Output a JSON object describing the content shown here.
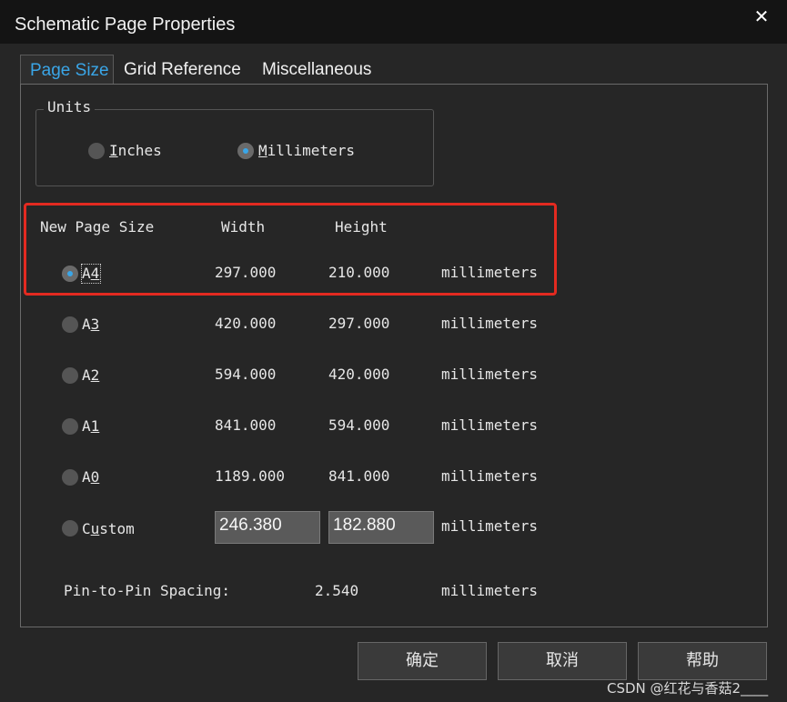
{
  "window": {
    "title": "Schematic Page Properties",
    "close_glyph": "✕"
  },
  "tabs": [
    {
      "label": "Page Size",
      "active": true
    },
    {
      "label": "Grid Reference",
      "active": false
    },
    {
      "label": "Miscellaneous",
      "active": false
    }
  ],
  "units": {
    "legend": "Units",
    "options": [
      {
        "first": "I",
        "rest": "nches",
        "selected": false
      },
      {
        "first": "M",
        "rest": "illimeters",
        "selected": true
      }
    ]
  },
  "page_size": {
    "headers": {
      "name": "New Page Size",
      "width": "Width",
      "height": "Height"
    },
    "rows": [
      {
        "pre": "A",
        "ul": "4",
        "post": "",
        "width": "297.000",
        "height": "210.000",
        "unit": "millimeters",
        "selected": true
      },
      {
        "pre": "A",
        "ul": "3",
        "post": "",
        "width": "420.000",
        "height": "297.000",
        "unit": "millimeters",
        "selected": false
      },
      {
        "pre": "A",
        "ul": "2",
        "post": "",
        "width": "594.000",
        "height": "420.000",
        "unit": "millimeters",
        "selected": false
      },
      {
        "pre": "A",
        "ul": "1",
        "post": "",
        "width": "841.000",
        "height": "594.000",
        "unit": "millimeters",
        "selected": false
      },
      {
        "pre": "A",
        "ul": "0",
        "post": "",
        "width": "1189.000",
        "height": "841.000",
        "unit": "millimeters",
        "selected": false
      }
    ],
    "custom": {
      "pre": "C",
      "ul": "u",
      "post": "stom",
      "width": "246.380",
      "height": "182.880",
      "unit": "millimeters",
      "selected": false
    }
  },
  "pin_spacing": {
    "label": "Pin-to-Pin Spacing:",
    "value": "2.540",
    "unit": "millimeters"
  },
  "buttons": {
    "ok": "确定",
    "cancel": "取消",
    "help": "帮助"
  },
  "watermark": "CSDN @红花与香菇2____",
  "colors": {
    "accent": "#3aa6e8",
    "highlight_border": "#e32a20"
  }
}
